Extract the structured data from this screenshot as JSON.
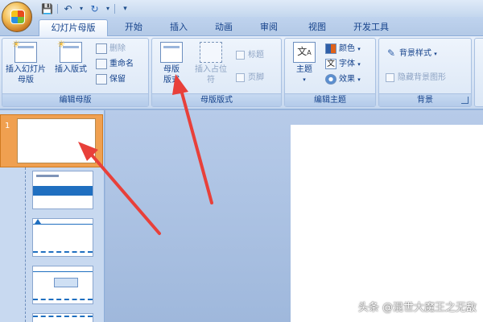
{
  "tabs": [
    "幻灯片母版",
    "开始",
    "插入",
    "动画",
    "审阅",
    "视图",
    "开发工具"
  ],
  "groups": {
    "edit_master": {
      "label": "编辑母版",
      "insert_slide_master": "插入幻灯片母版",
      "insert_layout": "插入版式",
      "delete": "删除",
      "rename": "重命名",
      "preserve": "保留"
    },
    "master_layout": {
      "label": "母版版式",
      "master_layout_btn": "母版版式",
      "insert_placeholder": "插入占位符",
      "title_chk": "标题",
      "footer_chk": "页脚"
    },
    "edit_theme": {
      "label": "编辑主题",
      "themes": "主题",
      "colors": "颜色",
      "fonts": "字体",
      "effects": "效果"
    },
    "background": {
      "label": "背景",
      "bg_styles": "背景样式",
      "hide_bg": "隐藏背景图形"
    }
  },
  "thumbnails": {
    "selected_number": "1"
  },
  "watermark": "头条 @混世大魔王之无敌",
  "colors": {
    "arrow": "#e8403a",
    "selected_thumb": "#f0a050",
    "ribbon": "#dbe7f6"
  },
  "icons": [
    "save-icon",
    "undo-icon",
    "redo-icon",
    "customize-qat-icon",
    "office-logo-icon"
  ]
}
